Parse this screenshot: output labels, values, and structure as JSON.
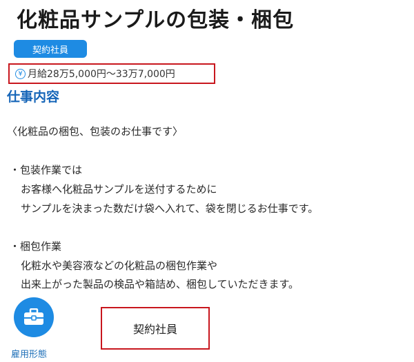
{
  "page": {
    "title": "化粧品サンプルの包装・梱包",
    "badge": "契約社員",
    "salary": {
      "icon": "yen-icon",
      "text": "月給28万5,000円〜33万7,000円"
    }
  },
  "job": {
    "heading": "仕事内容",
    "lines": [
      "〈化粧品の梱包、包装のお仕事です〉",
      "・包装作業では",
      "お客様へ化粧品サンプルを送付するために",
      "サンプルを決まった数だけ袋へ入れて、袋を閉じるお仕事です。",
      "・梱包作業",
      "化粧水や美容液などの化粧品の梱包作業や",
      "出来上がった製品の検品や箱詰め、梱包していただきます。"
    ]
  },
  "employment": {
    "icon": "briefcase-icon",
    "label": "雇用形態",
    "value": "契約社員"
  },
  "colors": {
    "accent": "#1e8be3",
    "heading": "#1565b8",
    "highlight_border": "#c8161d"
  }
}
